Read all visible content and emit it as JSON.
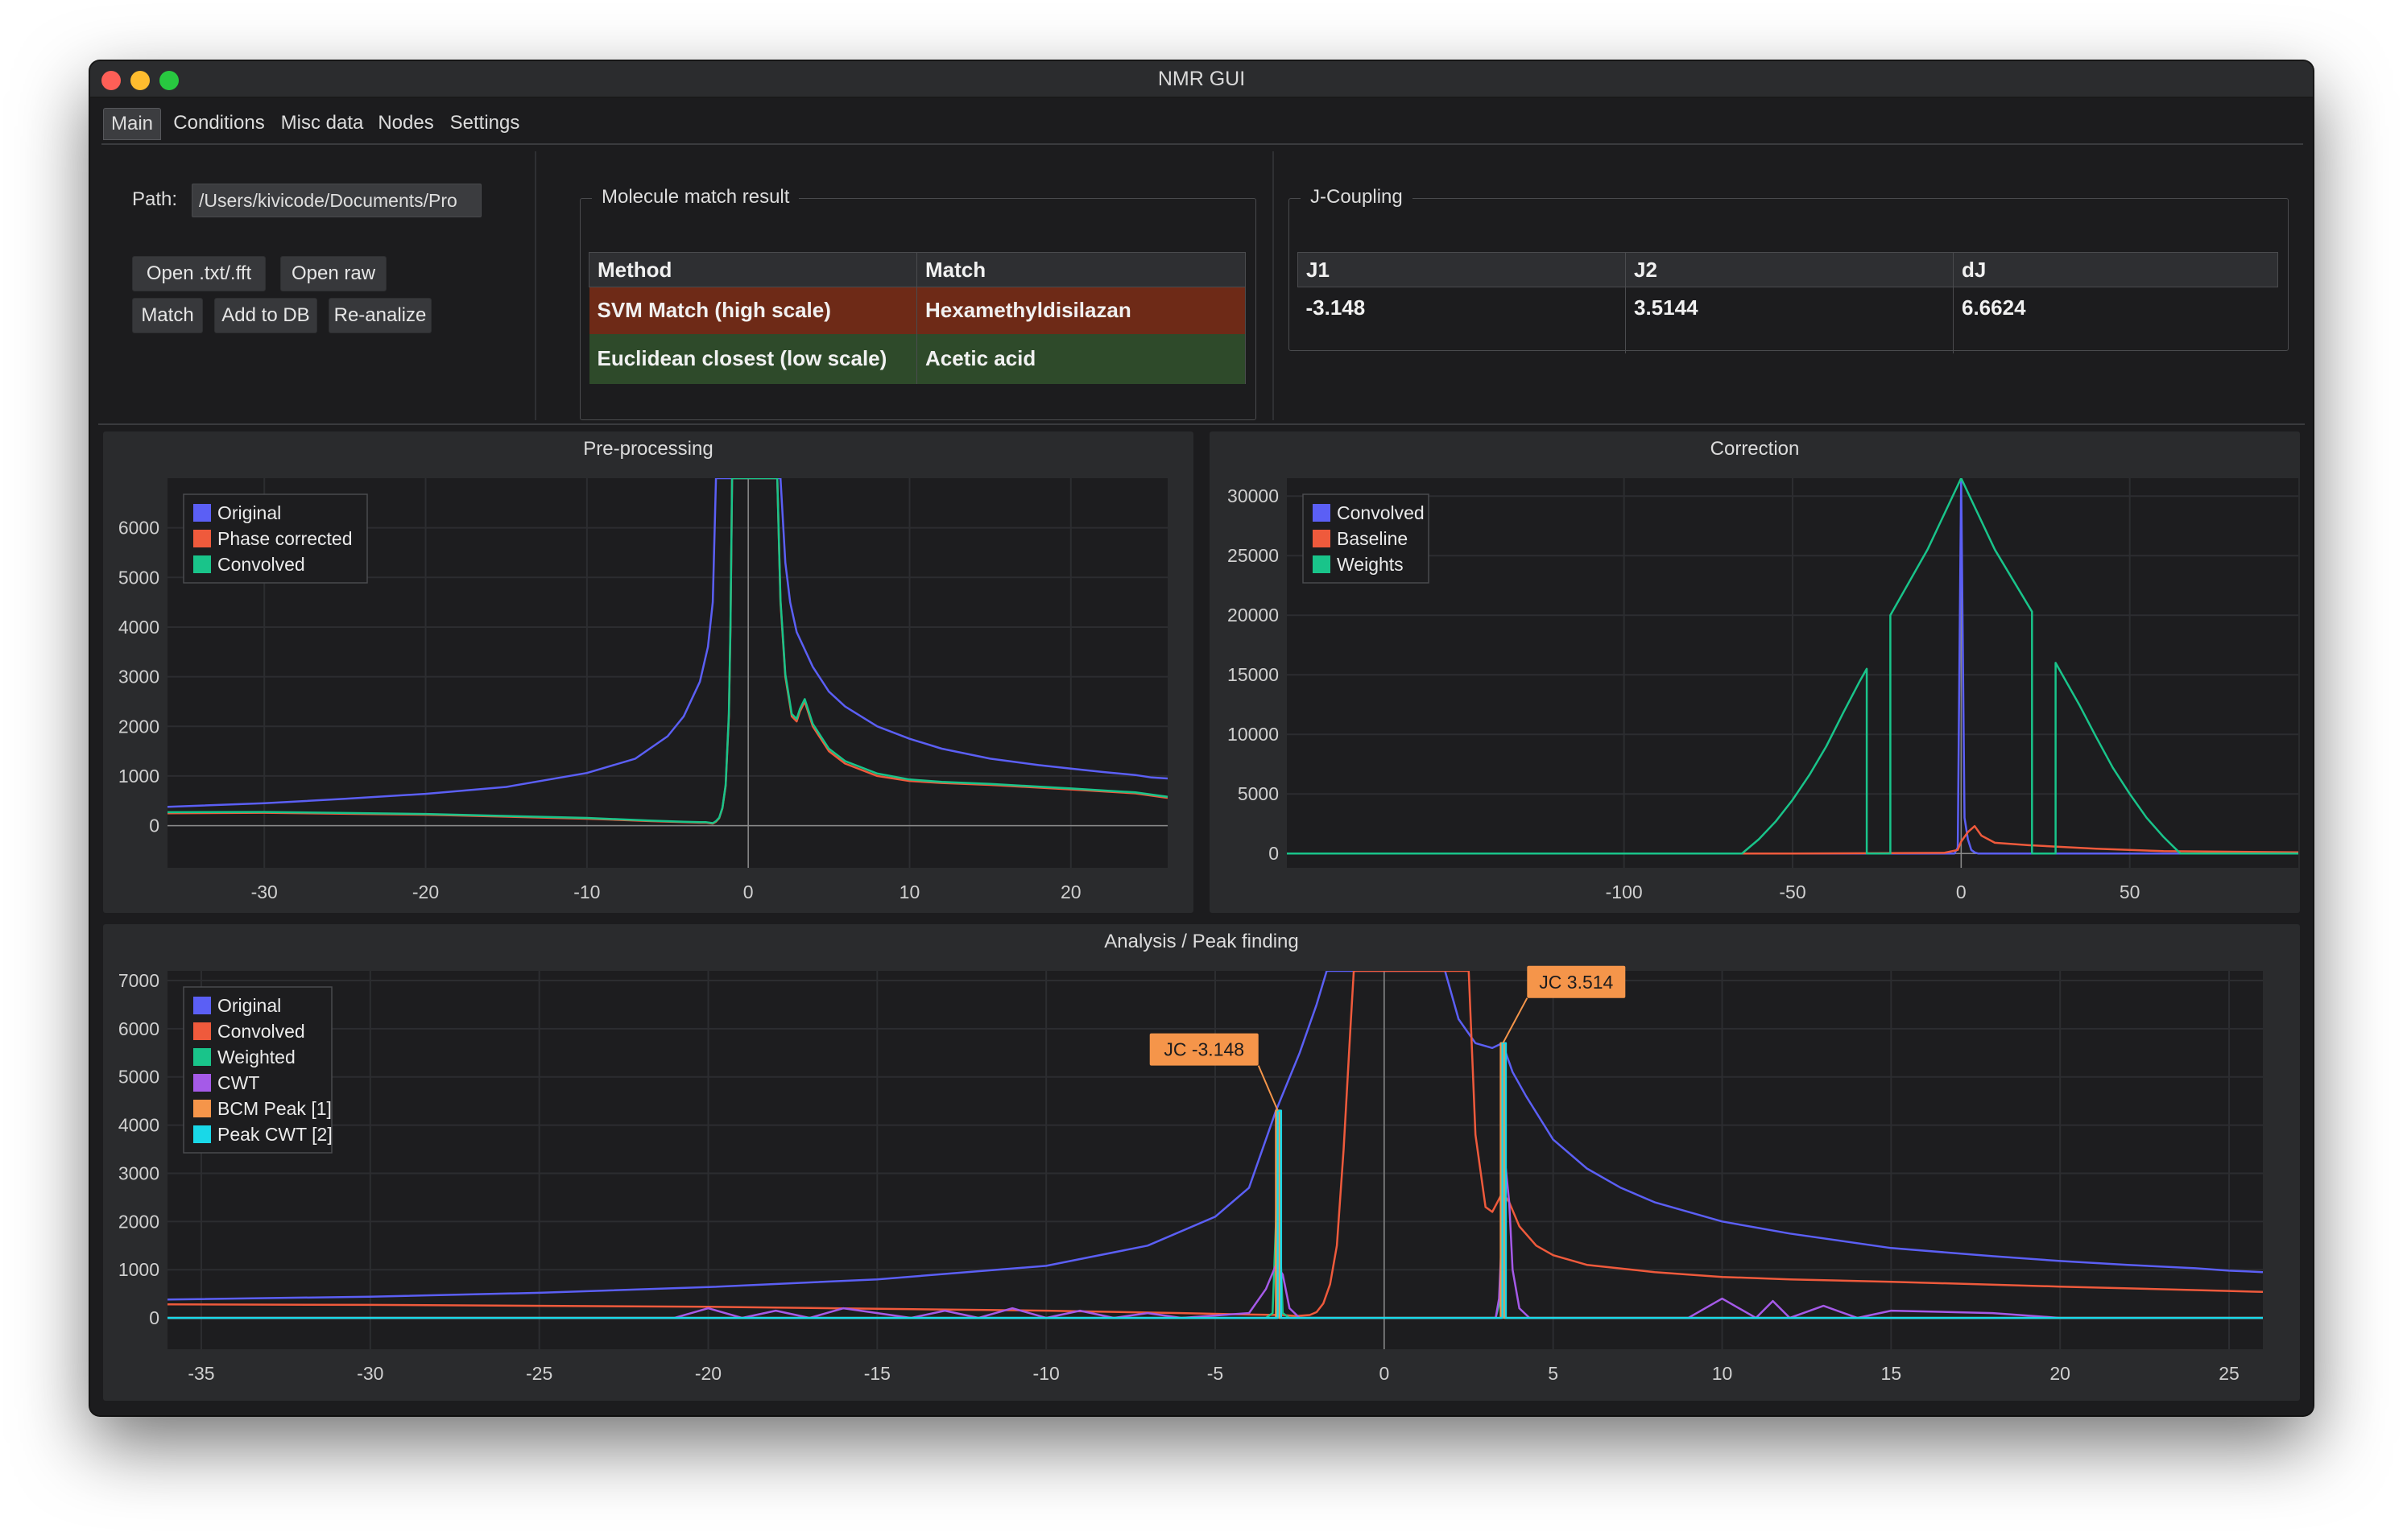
{
  "window": {
    "title": "NMR GUI"
  },
  "tabs": [
    "Main",
    "Conditions",
    "Misc data",
    "Nodes",
    "Settings"
  ],
  "path": {
    "label": "Path:",
    "value": "/Users/kivicode/Documents/Pro"
  },
  "buttons": {
    "open_txt": "Open .txt/.fft",
    "open_raw": "Open raw",
    "match": "Match",
    "add_db": "Add to DB",
    "reanalize": "Re-analize"
  },
  "match_result": {
    "title": "Molecule match result",
    "headers": [
      "Method",
      "Match"
    ],
    "rows": [
      {
        "method": "SVM Match (high scale)",
        "match": "Hexamethyldisilazan",
        "color": "#6e2a17"
      },
      {
        "method": "Euclidean closest (low scale)",
        "match": "Acetic acid",
        "color": "#2e4a2a"
      }
    ]
  },
  "j_coupling": {
    "title": "J-Coupling",
    "headers": [
      "J1",
      "J2",
      "dJ"
    ],
    "values": [
      "-3.148",
      "3.5144",
      "6.6624"
    ]
  },
  "colors": {
    "original": "#5b5ff5",
    "red": "#ef5a3c",
    "green": "#19c48a",
    "cwt": "#a55ae8",
    "bcm": "#f5954a",
    "peakcwt": "#19d8e8"
  },
  "charts": [
    {
      "title": "Pre-processing"
    },
    {
      "title": "Correction"
    },
    {
      "title": "Analysis / Peak finding"
    }
  ],
  "chart_data": [
    {
      "type": "line",
      "title": "Pre-processing",
      "xlim": [
        -36,
        26
      ],
      "ylim": [
        -850,
        7000
      ],
      "xticks": [
        -30,
        -20,
        -10,
        0,
        10,
        20
      ],
      "yticks": [
        0,
        1000,
        2000,
        3000,
        4000,
        5000,
        6000
      ],
      "legend_position": "top-left",
      "series": [
        {
          "name": "Original",
          "color": "#5b5ff5",
          "x": [
            -36,
            -30,
            -25,
            -20,
            -15,
            -10,
            -7,
            -5,
            -4,
            -3,
            -2.5,
            -2.2,
            -2,
            2,
            2.3,
            2.6,
            3,
            4,
            5,
            6,
            8,
            10,
            12,
            15,
            18,
            20,
            22,
            24,
            25,
            26
          ],
          "y": [
            380,
            450,
            540,
            640,
            780,
            1060,
            1350,
            1800,
            2200,
            2900,
            3600,
            4500,
            7000,
            7000,
            5300,
            4500,
            3900,
            3200,
            2700,
            2400,
            2000,
            1750,
            1550,
            1350,
            1220,
            1150,
            1080,
            1020,
            970,
            950
          ]
        },
        {
          "name": "Phase corrected",
          "color": "#ef5a3c",
          "x": [
            -36,
            -30,
            -20,
            -10,
            -6,
            -4,
            -3,
            -2.6,
            -2.2,
            -2,
            -1.8,
            -1.6,
            -1.4,
            -1.2,
            -1.1,
            -1,
            1.8,
            2,
            2.3,
            2.7,
            3,
            3.2,
            3.5,
            4,
            5,
            6,
            8,
            10,
            12,
            15,
            20,
            24,
            26
          ],
          "y": [
            250,
            260,
            220,
            140,
            90,
            70,
            60,
            60,
            40,
            80,
            150,
            350,
            800,
            2200,
            4000,
            7000,
            7000,
            4500,
            3000,
            2200,
            2100,
            2300,
            2500,
            2000,
            1500,
            1250,
            1000,
            900,
            860,
            820,
            730,
            650,
            560
          ]
        },
        {
          "name": "Convolved",
          "color": "#19c48a",
          "x": [
            -36,
            -30,
            -20,
            -10,
            -6,
            -4,
            -3,
            -2.6,
            -2.2,
            -2,
            -1.8,
            -1.6,
            -1.4,
            -1.2,
            -1.1,
            -1,
            1.8,
            2,
            2.3,
            2.7,
            3,
            3.2,
            3.5,
            4,
            5,
            6,
            8,
            10,
            12,
            15,
            20,
            24,
            26
          ],
          "y": [
            270,
            275,
            235,
            155,
            100,
            80,
            70,
            70,
            50,
            90,
            160,
            360,
            820,
            2250,
            4050,
            7000,
            7000,
            4550,
            3050,
            2250,
            2150,
            2350,
            2550,
            2050,
            1550,
            1300,
            1050,
            930,
            880,
            840,
            750,
            670,
            580
          ]
        }
      ]
    },
    {
      "type": "line",
      "title": "Correction",
      "xlim": [
        -200,
        100
      ],
      "ylim": [
        -1200,
        31500
      ],
      "xticks": [
        -100,
        -50,
        0,
        50
      ],
      "yticks": [
        0,
        5000,
        10000,
        15000,
        20000,
        25000,
        30000
      ],
      "legend_position": "top-left",
      "series": [
        {
          "name": "Convolved",
          "color": "#5b5ff5",
          "x": [
            -200,
            -2,
            -1,
            0,
            1,
            2,
            3,
            4,
            5,
            100
          ],
          "y": [
            0,
            0,
            500,
            31500,
            3000,
            1200,
            300,
            100,
            0,
            0
          ]
        },
        {
          "name": "Baseline",
          "color": "#ef5a3c",
          "x": [
            -200,
            -50,
            -5,
            -1,
            0,
            2,
            4,
            6,
            10,
            20,
            40,
            60,
            100
          ],
          "y": [
            0,
            0,
            60,
            300,
            1000,
            1800,
            2300,
            1500,
            900,
            700,
            400,
            200,
            100
          ]
        },
        {
          "name": "Weights",
          "color": "#19c48a",
          "x": [
            -200,
            -65,
            -60,
            -55,
            -50,
            -45,
            -40,
            -35,
            -30,
            -28,
            -28,
            -21,
            -21,
            -10,
            0,
            10,
            21,
            21,
            28,
            28,
            35,
            40,
            45,
            50,
            55,
            60,
            65,
            100
          ],
          "y": [
            0,
            0,
            1200,
            2700,
            4500,
            6600,
            9000,
            11800,
            14500,
            15500,
            0,
            0,
            20000,
            25500,
            31500,
            25500,
            20300,
            0,
            0,
            16000,
            12500,
            9800,
            7200,
            5000,
            3000,
            1400,
            0,
            0
          ]
        }
      ]
    },
    {
      "type": "line",
      "title": "Analysis / Peak finding",
      "xlim": [
        -36,
        26
      ],
      "ylim": [
        -650,
        7200
      ],
      "xticks": [
        -35,
        -30,
        -25,
        -20,
        -15,
        -10,
        -5,
        0,
        5,
        10,
        15,
        20,
        25
      ],
      "yticks": [
        0,
        1000,
        2000,
        3000,
        4000,
        5000,
        6000,
        7000
      ],
      "legend_position": "top-left",
      "annotations": [
        {
          "label": "JC -3.148",
          "x": -3.148,
          "y": 4300
        },
        {
          "label": "JC 3.514",
          "x": 3.514,
          "y": 5700
        }
      ],
      "series": [
        {
          "name": "Original",
          "color": "#5b5ff5",
          "x": [
            -36,
            -30,
            -25,
            -20,
            -15,
            -10,
            -7,
            -5,
            -4,
            -3.2,
            -2.5,
            -2,
            -1.7,
            1.8,
            2.2,
            2.7,
            3.2,
            3.5,
            3.8,
            4.2,
            5,
            6,
            7,
            8,
            10,
            12,
            15,
            18,
            20,
            22,
            24,
            25,
            26
          ],
          "y": [
            380,
            440,
            520,
            640,
            800,
            1080,
            1500,
            2100,
            2700,
            4300,
            5500,
            6500,
            7200,
            7200,
            6200,
            5700,
            5600,
            5700,
            5100,
            4600,
            3700,
            3100,
            2700,
            2400,
            2000,
            1750,
            1450,
            1280,
            1180,
            1100,
            1030,
            980,
            950
          ]
        },
        {
          "name": "Convolved",
          "color": "#ef5a3c",
          "x": [
            -36,
            -30,
            -20,
            -10,
            -6,
            -4,
            -3,
            -2.6,
            -2.2,
            -2,
            -1.8,
            -1.6,
            -1.4,
            -1.2,
            -1,
            -0.9,
            2.5,
            2.7,
            3,
            3.2,
            3.5,
            3.7,
            4,
            4.5,
            5,
            6,
            8,
            10,
            12,
            15,
            20,
            25,
            26
          ],
          "y": [
            280,
            270,
            230,
            150,
            100,
            70,
            60,
            40,
            60,
            120,
            300,
            700,
            1500,
            3500,
            6000,
            7200,
            7200,
            3800,
            2300,
            2200,
            2600,
            2400,
            1900,
            1500,
            1300,
            1100,
            950,
            850,
            800,
            750,
            650,
            560,
            540
          ]
        },
        {
          "name": "Weighted",
          "color": "#19c48a",
          "x": [
            -36,
            -3.5,
            -3.3,
            -3.2,
            -3.15,
            -3.1,
            -3.0,
            -2.8,
            3.3,
            3.45,
            3.5,
            3.55,
            3.6,
            3.7,
            26
          ],
          "y": [
            0,
            0,
            100,
            2000,
            4300,
            2000,
            100,
            0,
            0,
            400,
            5700,
            400,
            0,
            0,
            0
          ]
        },
        {
          "name": "CWT",
          "color": "#a55ae8",
          "x": [
            -36,
            -21,
            -20,
            -19,
            -18,
            -17,
            -16,
            -14,
            -13,
            -12,
            -11,
            -10,
            -9,
            -8,
            -7,
            -6,
            -5,
            -4,
            -3.5,
            -3.2,
            -3,
            -2.8,
            -2.5,
            -2,
            3.3,
            3.4,
            3.5,
            3.6,
            3.7,
            3.8,
            4,
            4.3,
            5,
            9,
            10,
            11,
            11.5,
            12,
            13,
            14,
            15,
            18,
            20,
            26
          ],
          "y": [
            0,
            0,
            200,
            0,
            150,
            0,
            200,
            0,
            150,
            0,
            200,
            0,
            150,
            0,
            100,
            0,
            50,
            100,
            600,
            1100,
            900,
            200,
            0,
            0,
            0,
            400,
            2000,
            3100,
            2400,
            1000,
            200,
            0,
            0,
            0,
            400,
            0,
            350,
            0,
            250,
            0,
            150,
            100,
            0,
            0
          ]
        },
        {
          "name": "BCM Peak [1]",
          "color": "#f5954a",
          "x": [
            -36,
            -3.2,
            -3.2,
            -3.1,
            -3.1,
            3.45,
            3.45,
            3.55,
            3.55,
            26
          ],
          "y": [
            0,
            0,
            4300,
            4300,
            0,
            0,
            5700,
            5700,
            0,
            0
          ]
        },
        {
          "name": "Peak CWT [2]",
          "color": "#19d8e8",
          "x": [
            -36,
            -3.15,
            -3.15,
            -3.05,
            -3.05,
            3.5,
            3.5,
            3.6,
            3.6,
            26
          ],
          "y": [
            0,
            0,
            4300,
            4300,
            0,
            0,
            5700,
            5700,
            0,
            0
          ]
        }
      ]
    }
  ]
}
